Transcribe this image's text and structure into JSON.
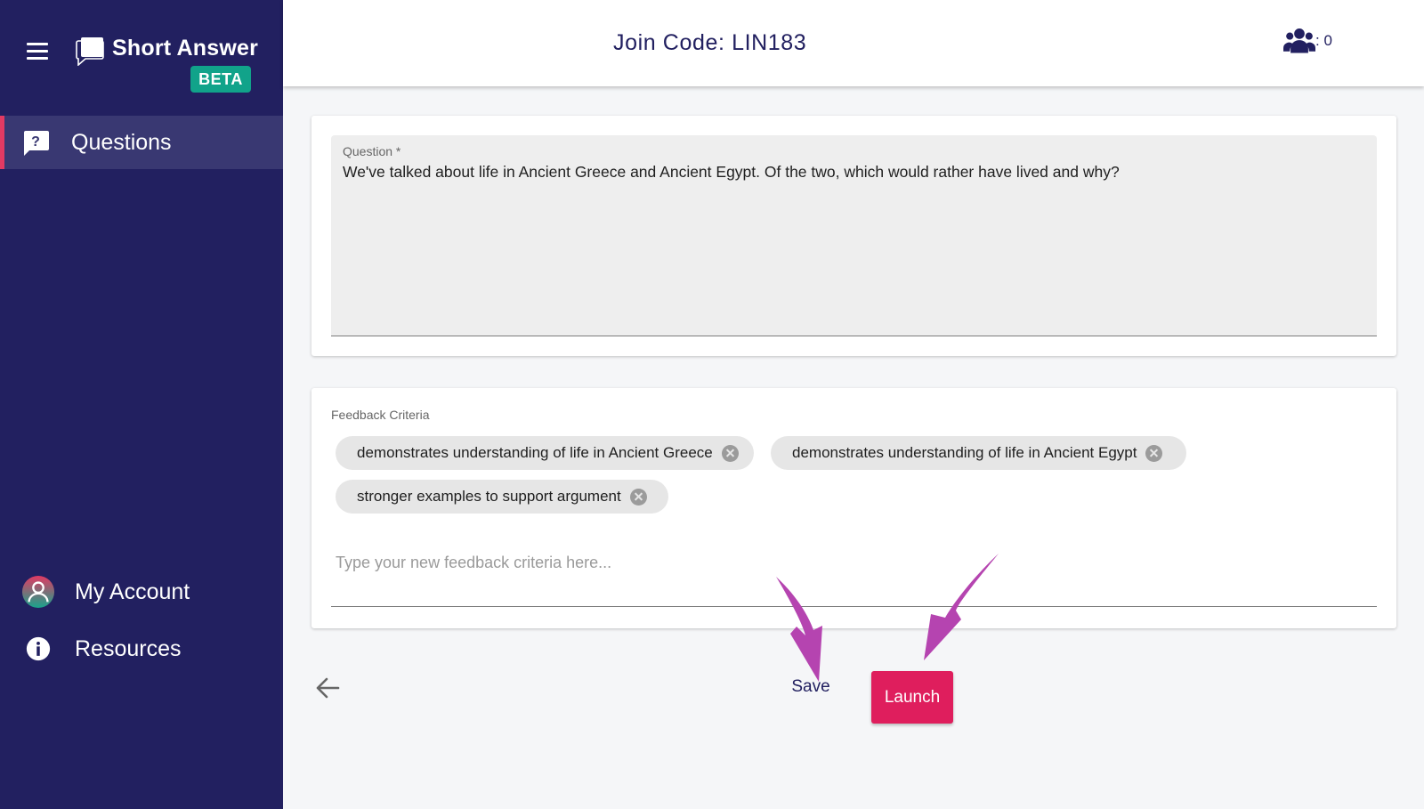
{
  "sidebar": {
    "app_title": "Short Answer",
    "badge": "BETA",
    "menu_icon": "hamburger-icon",
    "nav": [
      {
        "label": "Questions",
        "icon": "question-chat-icon",
        "active": true
      },
      {
        "label": "My Account",
        "icon": "avatar-icon"
      },
      {
        "label": "Resources",
        "icon": "info-icon"
      }
    ]
  },
  "header": {
    "join_code": "Join Code: LIN183",
    "participants": ": 0",
    "participants_icon": "users-icon"
  },
  "question": {
    "label": "Question *",
    "text": "We've talked about life in Ancient Greece and Ancient Egypt. Of the two, which would rather have lived and why?"
  },
  "feedback": {
    "label": "Feedback Criteria",
    "chips": [
      "demonstrates understanding of life in Ancient Greece",
      "demonstrates understanding of life in Ancient Egypt",
      "stronger examples to support argument"
    ],
    "placeholder": "Type your new feedback criteria here..."
  },
  "actions": {
    "save": "Save",
    "launch": "Launch"
  },
  "colors": {
    "sidebar": "#222060",
    "accent": "#df1e5d",
    "badge": "#11a38a",
    "annotation_arrow": "#b544b0"
  }
}
